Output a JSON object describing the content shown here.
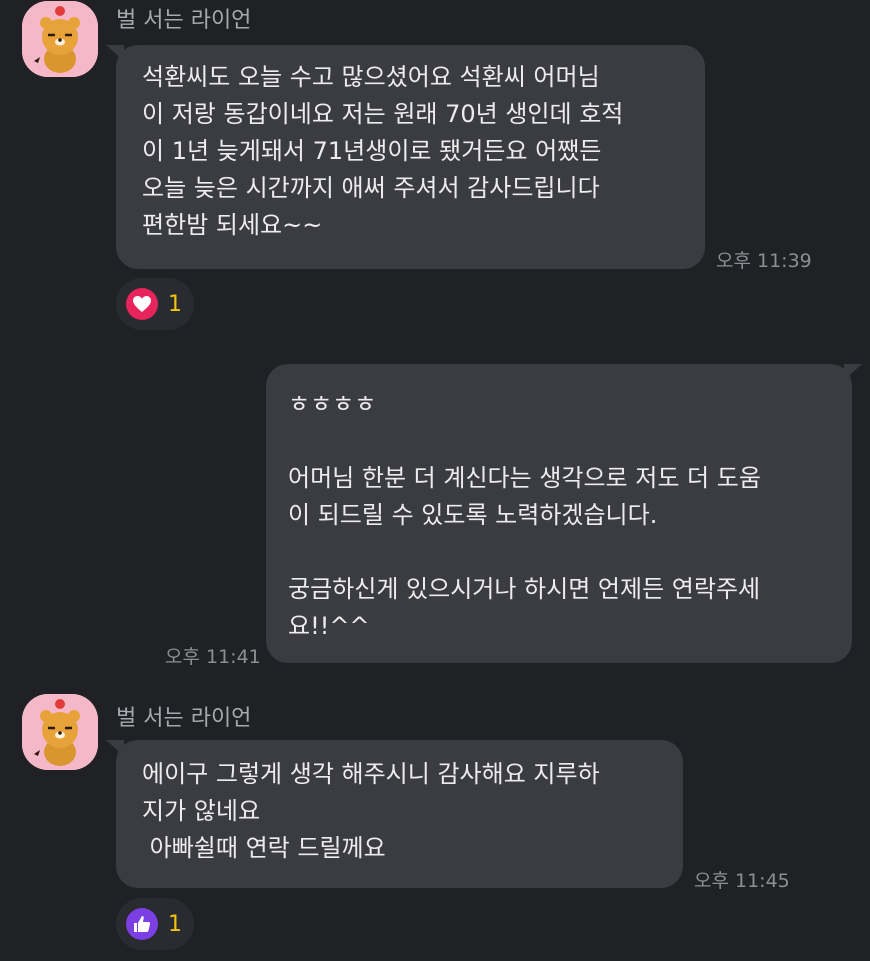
{
  "messages": [
    {
      "sender": "벌 서는 라이언",
      "text": "석환씨도 오늘 수고 많으셨어요 석환씨 어머님\n이 저랑 동갑이네요 저는 원래 70년 생인데 호적\n이 1년 늦게돼서 71년생이로 됐거든요 어쨌든\n오늘 늦은 시간까지 애써 주셔서 감사드립니다\n편한밤 되세요~~",
      "time": "오후 11:39",
      "reaction": {
        "icon": "heart-icon",
        "color": "#e8245c",
        "count": "1"
      }
    },
    {
      "text": "ㅎㅎㅎㅎ\n\n어머님 한분 더 계신다는 생각으로 저도 더 도움\n이 되드릴 수 있도록 노력하겠습니다.\n\n궁금하신게 있으시거나 하시면 언제든 연락주세\n요!!^^",
      "time": "오후 11:41"
    },
    {
      "sender": "벌 서는 라이언",
      "text": "에이구 그렇게 생각 해주시니 감사해요 지루하\n지가 않네요\n 아빠쉴때 연락 드릴께요",
      "time": "오후 11:45",
      "reaction": {
        "icon": "thumbs-up-icon",
        "color": "#7b3fe4",
        "count": "1"
      }
    }
  ]
}
